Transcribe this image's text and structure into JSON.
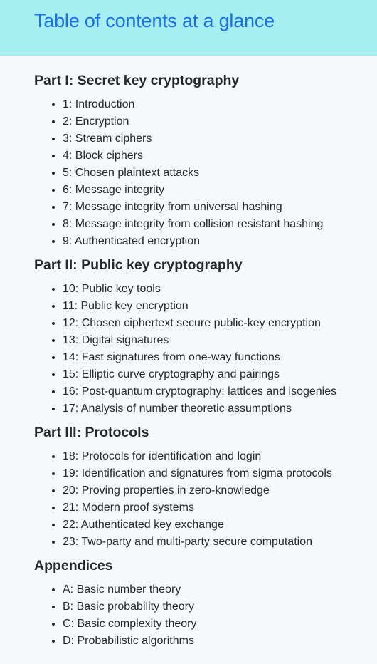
{
  "page_title": "Table of contents at a glance",
  "parts": [
    {
      "title": "Part I: Secret key cryptography",
      "chapters": [
        "1: Introduction",
        "2: Encryption",
        "3: Stream ciphers",
        "4: Block ciphers",
        "5: Chosen plaintext attacks",
        "6: Message integrity",
        "7: Message integrity from universal hashing",
        "8: Message integrity from collision resistant hashing",
        "9: Authenticated encryption"
      ]
    },
    {
      "title": "Part II: Public key cryptography",
      "chapters": [
        "10: Public key tools",
        "11: Public key encryption",
        "12: Chosen ciphertext secure public-key encryption",
        "13: Digital signatures",
        "14: Fast signatures from one-way functions",
        "15: Elliptic curve cryptography and pairings",
        "16: Post-quantum cryptography: lattices and isogenies",
        "17: Analysis of number theoretic assumptions"
      ]
    },
    {
      "title": "Part III: Protocols",
      "chapters": [
        "18: Protocols for identification and login",
        "19: Identification and signatures from sigma protocols",
        "20: Proving properties in zero-knowledge",
        "21: Modern proof systems",
        "22: Authenticated key exchange",
        "23: Two-party and multi-party secure computation"
      ]
    },
    {
      "title": "Appendices",
      "chapters": [
        "A: Basic number theory",
        "B: Basic probability theory",
        "C: Basic complexity theory",
        "D: Probabilistic algorithms"
      ]
    }
  ],
  "colors": {
    "header_bg": "#a6eff0",
    "title": "#1a6df5",
    "page_bg": "#f6f8fa",
    "text": "#24292e"
  }
}
